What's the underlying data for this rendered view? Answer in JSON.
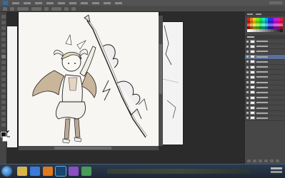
{
  "menubar": {
    "items": [
      "",
      "",
      "",
      "",
      "",
      "",
      "",
      "",
      "",
      "",
      ""
    ]
  },
  "document": {
    "tab_title": ""
  },
  "taskbar": {
    "apps": [
      "explorer",
      "browser",
      "media",
      "photoshop",
      "paint",
      "app6"
    ]
  },
  "colors": {
    "workspace": "#2b2b2b",
    "panel": "#474747",
    "selection": "#5a6f9a",
    "taskbar": "#1d2836"
  },
  "layers": {
    "rows": 16,
    "selected_index": 3
  }
}
